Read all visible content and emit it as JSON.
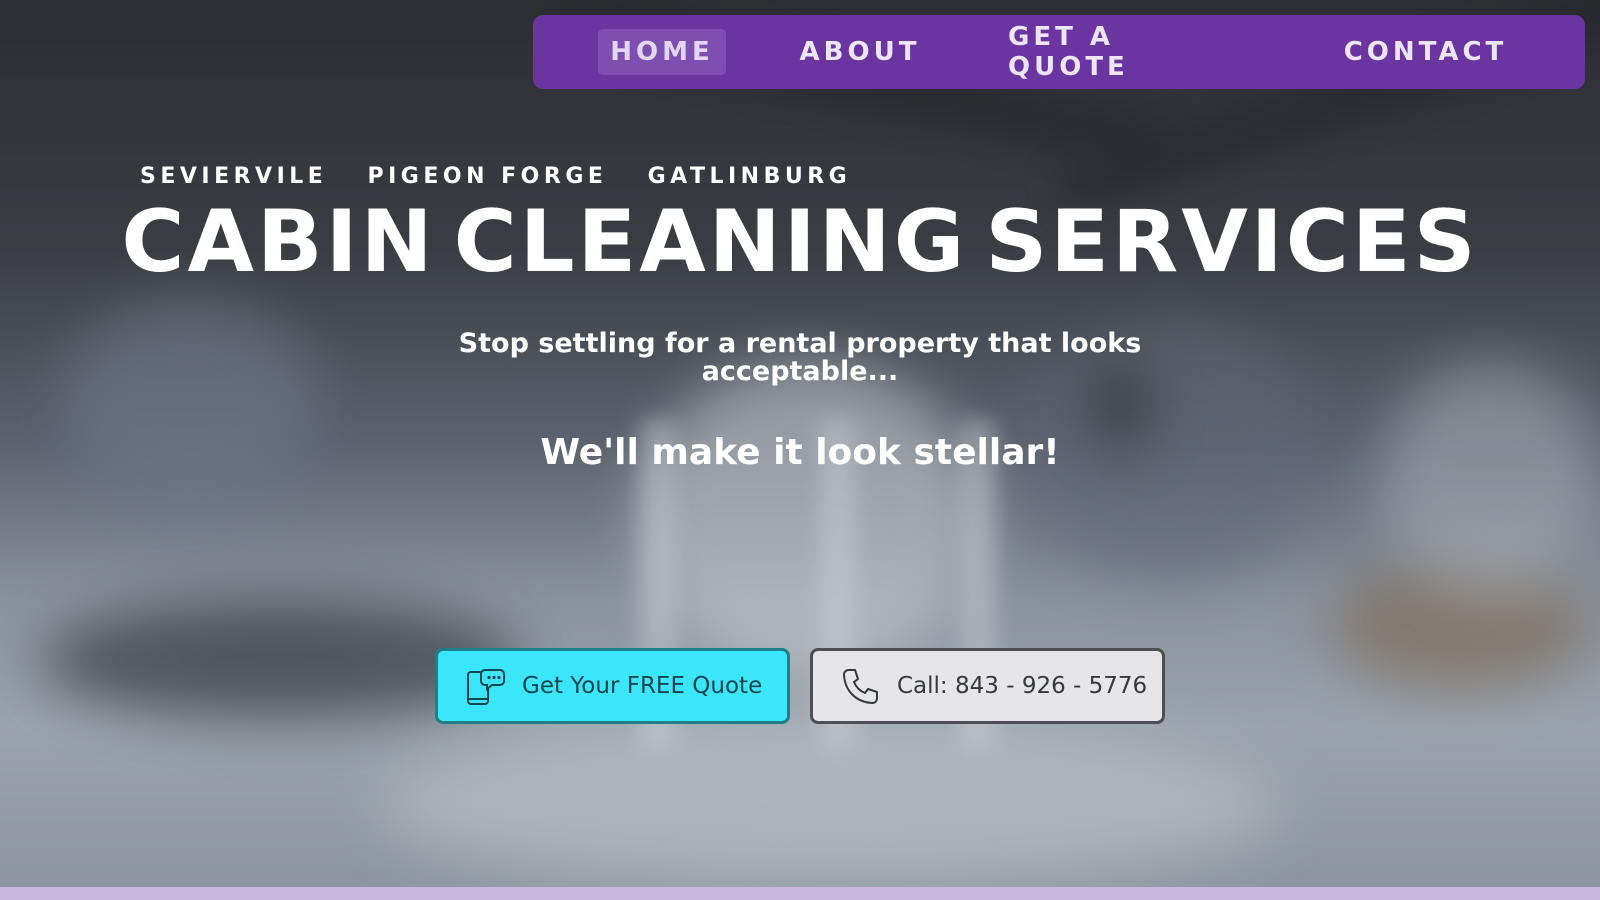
{
  "nav": {
    "items": [
      {
        "label": "HOME",
        "active": true
      },
      {
        "label": "ABOUT",
        "active": false
      },
      {
        "label": "GET A QUOTE",
        "active": false
      },
      {
        "label": "CONTACT",
        "active": false
      }
    ]
  },
  "hero": {
    "locations": [
      "SEVIERVILE",
      "PIGEON FORGE",
      "GATLINBURG"
    ],
    "title_words": [
      "CABIN",
      "CLEANING",
      "SERVICES"
    ],
    "subtitle": "Stop settling for a rental property that looks acceptable...",
    "tagline": "We'll make it look stellar!"
  },
  "cta": {
    "quote_label": "Get Your FREE Quote",
    "quote_icon": "phone-chat-icon",
    "call_label": "Call: 843 - 926 - 5776",
    "call_icon": "phone-icon"
  },
  "colors": {
    "nav_bg": "#6a35a1",
    "quote_button": "#3ce6fa",
    "call_button": "#e6e6e8"
  }
}
